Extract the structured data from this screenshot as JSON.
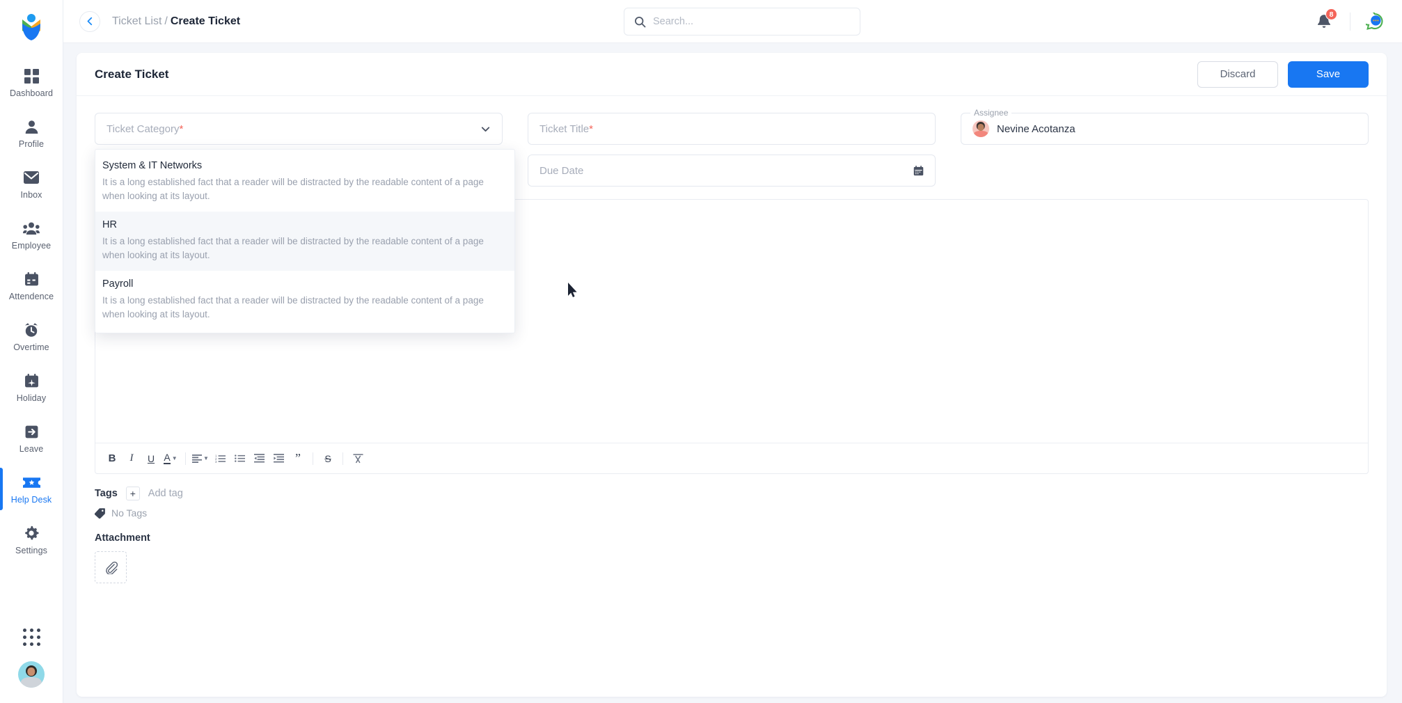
{
  "sidebar": {
    "brand_icon": "tulip-logo-icon",
    "items": [
      {
        "label": "Dashboard",
        "icon": "grid-icon",
        "active": false
      },
      {
        "label": "Profile",
        "icon": "person-icon",
        "active": false
      },
      {
        "label": "Inbox",
        "icon": "envelope-icon",
        "active": false
      },
      {
        "label": "Employee",
        "icon": "people-icon",
        "active": false
      },
      {
        "label": "Attendence",
        "icon": "calendar-icon",
        "active": false
      },
      {
        "label": "Overtime",
        "icon": "alarm-clock-icon",
        "active": false
      },
      {
        "label": "Holiday",
        "icon": "calendar-plane-icon",
        "active": false
      },
      {
        "label": "Leave",
        "icon": "exit-arrow-icon",
        "active": false
      },
      {
        "label": "Help Desk",
        "icon": "ticket-star-icon",
        "active": true
      },
      {
        "label": "Settings",
        "icon": "gear-icon",
        "active": false
      }
    ],
    "apps_icon": "apps-grid-icon",
    "user_avatar": "user-avatar"
  },
  "topbar": {
    "back_icon": "chevron-left-icon",
    "breadcrumb_root": "Ticket List",
    "breadcrumb_sep": "/",
    "breadcrumb_current": "Create Ticket",
    "search_placeholder": "Search...",
    "search_value": "",
    "search_icon": "search-icon",
    "bell_icon": "bell-icon",
    "bell_badge": "8",
    "chat_icon": "chat-bubble-icon"
  },
  "card": {
    "title": "Create Ticket",
    "discard_label": "Discard",
    "save_label": "Save"
  },
  "form": {
    "category": {
      "placeholder": "Ticket Category",
      "required_mark": "*",
      "value": "",
      "chevron_icon": "chevron-down-icon",
      "open": true,
      "options": [
        {
          "title": "System & IT Networks",
          "description": "It is a long established fact that a reader will be distracted by the readable content of a page when looking at its layout.",
          "hovered": false
        },
        {
          "title": "HR",
          "description": "It is a long established fact that a reader will be distracted by the readable content of a page when looking at its layout.",
          "hovered": true
        },
        {
          "title": "Payroll",
          "description": "It is a long established fact that a reader will be distracted by the readable content of a page when looking at its layout.",
          "hovered": false
        }
      ]
    },
    "title_field": {
      "placeholder": "Ticket Title",
      "required_mark": "*",
      "value": ""
    },
    "due_date": {
      "placeholder": "Due Date",
      "value": "",
      "calendar_icon": "calendar-icon"
    },
    "assignee": {
      "label": "Assignee",
      "value": "Nevine Acotanza",
      "avatar_icon": "assignee-avatar"
    }
  },
  "editor": {
    "content": "",
    "toolbar": [
      {
        "name": "bold",
        "glyph": "B"
      },
      {
        "name": "italic",
        "glyph": "I"
      },
      {
        "name": "underline",
        "glyph": "U"
      },
      {
        "name": "text-color",
        "glyph": "A"
      },
      {
        "name": "align",
        "glyph": "align"
      },
      {
        "name": "ordered-list",
        "glyph": "ol"
      },
      {
        "name": "unordered-list",
        "glyph": "ul"
      },
      {
        "name": "outdent",
        "glyph": "outdent"
      },
      {
        "name": "indent",
        "glyph": "indent"
      },
      {
        "name": "blockquote",
        "glyph": "”"
      },
      {
        "name": "strikethrough",
        "glyph": "S"
      },
      {
        "name": "clear-format",
        "glyph": "clear"
      }
    ]
  },
  "tags": {
    "label": "Tags",
    "add_btn": "+",
    "add_text": "Add tag",
    "empty_text": "No Tags",
    "tag_icon": "tag-icon"
  },
  "attachment": {
    "label": "Attachment",
    "clip_icon": "paperclip-icon"
  },
  "colors": {
    "accent": "#1877f2",
    "page_bg": "#f4f6fa",
    "badge": "#f4655a",
    "required": "#f4655a",
    "muted_text": "#9aa1ad"
  }
}
